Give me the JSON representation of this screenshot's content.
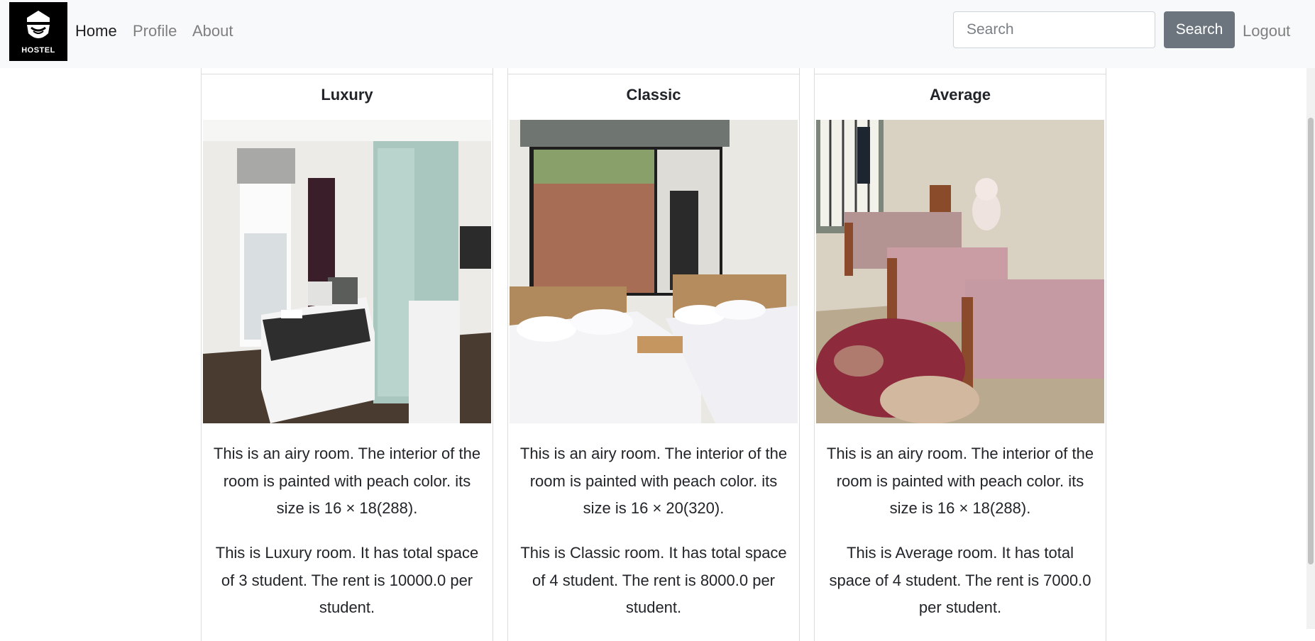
{
  "navbar": {
    "logo_text": "HOSTEL",
    "links": [
      {
        "label": "Home",
        "active": true
      },
      {
        "label": "Profile",
        "active": false
      },
      {
        "label": "About",
        "active": false
      }
    ],
    "search": {
      "placeholder": "Search",
      "value": ""
    },
    "search_button_label": "Search",
    "logout_label": "Logout"
  },
  "rooms": [
    {
      "title": "Luxury",
      "image_icon": "luxury-room-photo",
      "description": "This is an airy room. The interior of the room is painted with peach color. its size is 16 × 18(288).",
      "details": "This is Luxury room. It has total space of 3 student. The rent is 10000.0 per student."
    },
    {
      "title": "Classic",
      "image_icon": "classic-room-photo",
      "description": "This is an airy room. The interior of the room is painted with peach color. its size is 16 × 20(320).",
      "details": "This is Classic room. It has total space of 4 student. The rent is 8000.0 per student."
    },
    {
      "title": "Average",
      "image_icon": "average-room-photo",
      "description": "This is an airy room. The interior of the room is painted with peach color. its size is 16 × 18(288).",
      "details": "This is Average room. It has total space of 4 student. The rent is 7000.0 per student."
    }
  ],
  "colors": {
    "navbar_bg": "#f8f9fa",
    "search_button_bg": "#6c757d",
    "nav_active": "#1f1f1f",
    "nav_inactive": "#7f7f7f"
  }
}
